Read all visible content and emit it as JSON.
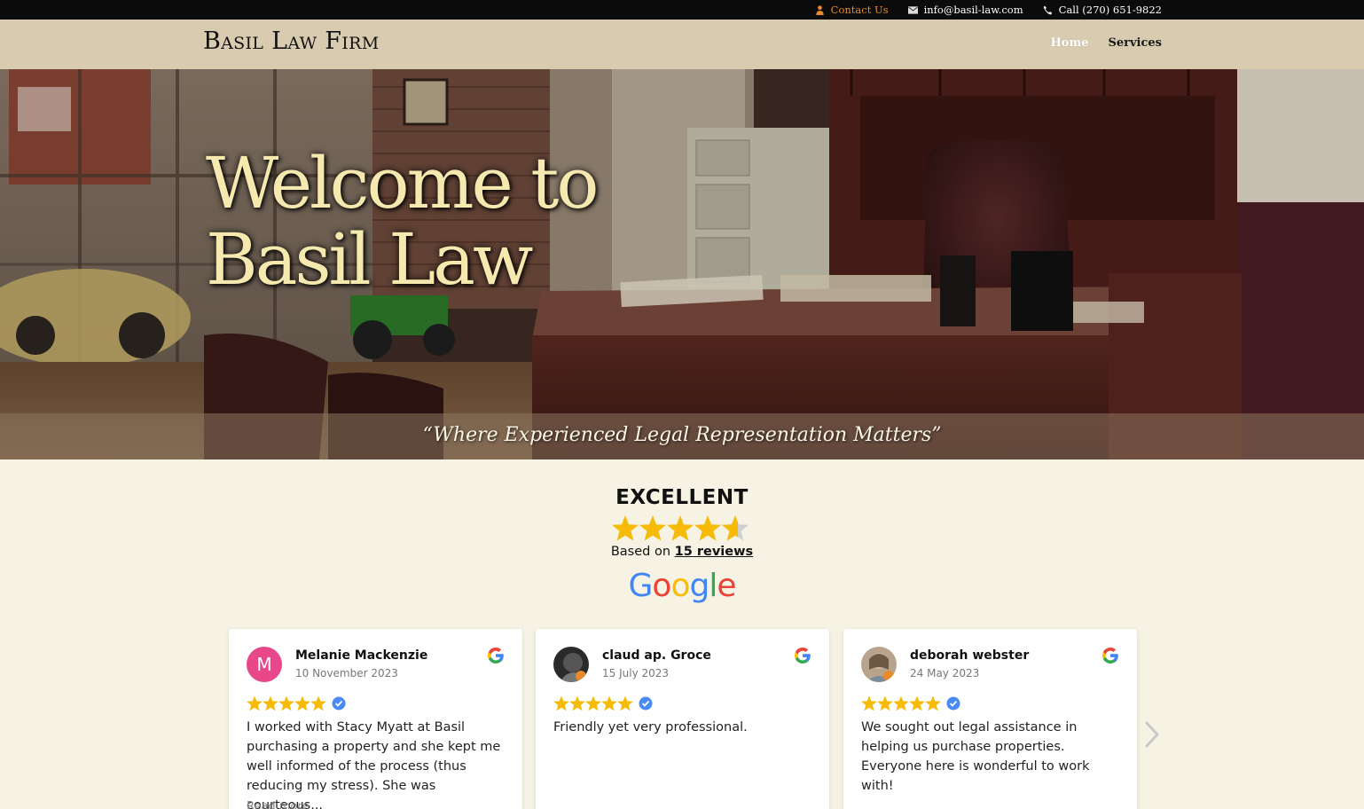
{
  "topbar": {
    "contact_label": "Contact Us",
    "email": "info@basil-law.com",
    "phone": "Call (270) 651-9822"
  },
  "header": {
    "logo": "Basil Law Firm",
    "nav": [
      {
        "label": "Home",
        "active": true
      },
      {
        "label": "Services",
        "active": false
      }
    ]
  },
  "hero": {
    "title_line1": "Welcome to",
    "title_line2": "Basil Law",
    "tagline": "“Where Experienced Legal Representation Matters”"
  },
  "reviews_summary": {
    "rating_word": "EXCELLENT",
    "stars": 4.6,
    "based_on_prefix": "Based on",
    "review_count_label": "15 reviews",
    "platform": "Google"
  },
  "reviews": [
    {
      "name": "Melanie Mackenzie",
      "date": "10 November 2023",
      "initial": "M",
      "stars": 5,
      "text": "I worked with Stacy Myatt at Basil purchasing a property and she kept me well informed of the process (thus reducing my stress). She was courteous...",
      "read_more": "Read more"
    },
    {
      "name": "claud ap. Groce",
      "date": "15 July 2023",
      "stars": 5,
      "text": "Friendly yet very professional."
    },
    {
      "name": "deborah webster",
      "date": "24 May 2023",
      "stars": 5,
      "text": "We sought out legal assistance in helping us purchase properties. Everyone here is wonderful to work with!"
    }
  ],
  "colors": {
    "topbar_bg": "#0b0b0b",
    "header_bg": "#d9cbaf",
    "contact_accent": "#e8892b",
    "page_bg": "#f6f3e4",
    "star_gold": "#f6bb06",
    "hero_title": "#f5e9b0"
  }
}
